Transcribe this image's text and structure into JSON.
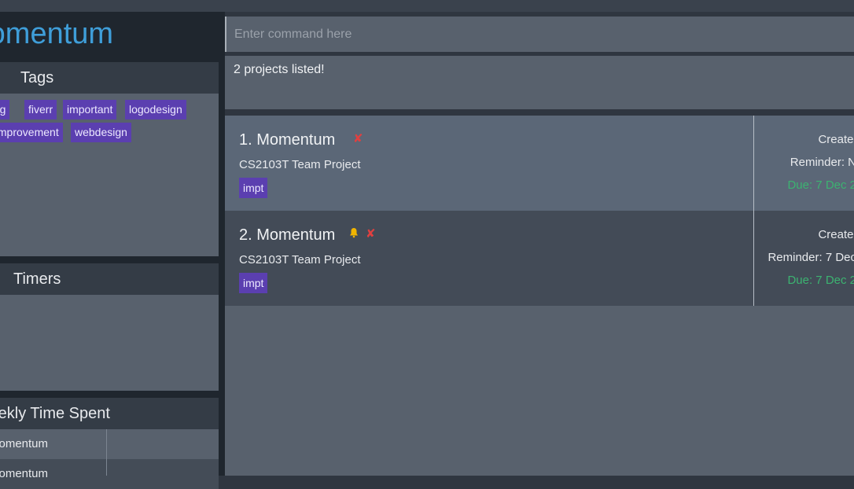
{
  "app": {
    "title": "Momentum"
  },
  "tags_panel": {
    "title": "Tags",
    "tags": [
      "writing",
      "fiverr",
      "important",
      "logodesign",
      "selfimprovement",
      "webdesign"
    ]
  },
  "timers_panel": {
    "title": "Timers"
  },
  "weekly_panel": {
    "title": "Weekly Time Spent",
    "rows": [
      {
        "name": "Momentum"
      },
      {
        "name": "Momentum"
      }
    ]
  },
  "command": {
    "placeholder": "Enter command here",
    "value": ""
  },
  "result": {
    "text": "2 projects listed!"
  },
  "projects": [
    {
      "title": "1. Momentum",
      "description": "CS2103T Team Project",
      "tag": "impt",
      "created": "Created:",
      "reminder": "Reminder: N",
      "due": "Due: 7 Dec 2",
      "has_reminder_icon": false
    },
    {
      "title": "2. Momentum",
      "description": "CS2103T Team Project",
      "tag": "impt",
      "created": "Created:",
      "reminder": "Reminder: 7 Dec",
      "due": "Due: 7 Dec 2",
      "has_reminder_icon": true
    }
  ],
  "colors": {
    "accent": "#3f9ed9",
    "tag": "#5b3fb0",
    "due": "#3cb371",
    "incomplete": "#e04040",
    "bell": "#f0b400"
  },
  "icons": {
    "incomplete": "✘",
    "bell": "bell-icon"
  }
}
